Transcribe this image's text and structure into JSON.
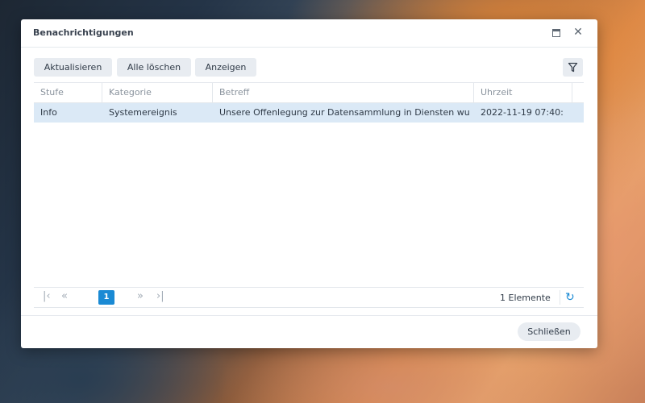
{
  "dialog": {
    "title": "Benachrichtigungen",
    "maximize_icon": "maximize-icon",
    "close_icon": "close-icon"
  },
  "toolbar": {
    "refresh_label": "Aktualisieren",
    "clear_all_label": "Alle löschen",
    "show_label": "Anzeigen",
    "filter_icon": "filter-icon"
  },
  "table": {
    "columns": [
      "Stufe",
      "Kategorie",
      "Betreff",
      "Uhrzeit"
    ],
    "rows": [
      {
        "level": "Info",
        "category": "Systemereignis",
        "subject": "Unsere Offenlegung zur Datensammlung in Diensten wu",
        "time": "2022-11-19 07:40:"
      }
    ]
  },
  "pager": {
    "current_page": "1",
    "count_text": "1 Elemente",
    "refresh_icon": "refresh-icon"
  },
  "footer": {
    "close_label": "Schließen"
  },
  "colors": {
    "accent": "#1a8ad4",
    "selected_row": "#dbe9f6"
  }
}
